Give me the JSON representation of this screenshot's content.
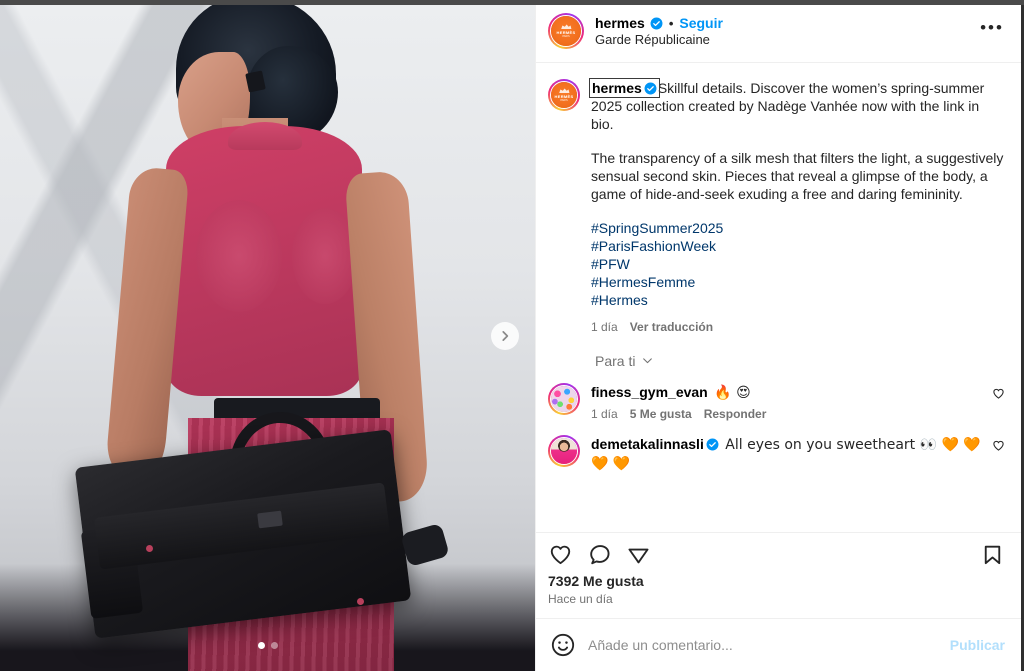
{
  "post": {
    "header": {
      "username": "hermes",
      "verified": true,
      "separator": "•",
      "follow_label": "Seguir",
      "location": "Garde Républicaine",
      "more_label": "•••",
      "avatar": {
        "name": "hermes-avatar",
        "logo_text": "HERMÈS",
        "logo_sub": "PARIS"
      }
    },
    "caption": {
      "username": "hermes",
      "verified": true,
      "paragraph1": "Skillful details. Discover the women’s spring-summer 2025 collection created by Nadège Vanhée now with the link in bio.",
      "paragraph2": "The transparency of a silk mesh that filters the light, a suggestively sensual second skin. Pieces that reveal a glimpse of the body, a game of hide-and-seek exuding a free and daring femininity.",
      "hashtags": [
        "#SpringSummer2025",
        "#ParisFashionWeek",
        "#PFW",
        "#HermesFemme",
        "#Hermes"
      ],
      "time": "1 día",
      "translate_label": "Ver traducción"
    },
    "comments_filter": {
      "label": "Para ti",
      "icon": "chevron-down-icon"
    },
    "comments": [
      {
        "username": "finess_gym_evan",
        "verified": false,
        "text": " 🔥 😍",
        "time": "1 día",
        "likes": "5 Me gusta",
        "reply": "Responder",
        "avatar": "confetti"
      },
      {
        "username": "demetakalinnasli",
        "verified": true,
        "text": " All eyes on you sweetheart 👀 🧡 🧡 🧡 🧡",
        "time": "",
        "likes": "",
        "reply": "",
        "avatar": "portrait"
      }
    ],
    "actions": {
      "like": "heart-icon",
      "comment": "comment-icon",
      "share": "share-icon",
      "save": "bookmark-icon"
    },
    "likes_count": "7392 Me gusta",
    "posted_time": "Hace un día",
    "add_comment": {
      "placeholder": "Añade un comentario...",
      "publish_label": "Publicar",
      "emoji_icon": "smiley-icon"
    }
  },
  "media": {
    "carousel": {
      "next_label": "chevron-right-icon",
      "dots_total": 2,
      "active_dot": 1
    },
    "alt": "Model seen from behind in pink sheer Hermès top holding a black Birkin-style bag"
  },
  "colors": {
    "link_blue": "#0095f6",
    "hashtag_blue": "#00376b",
    "muted_gray": "#737373",
    "text_dark": "#262626",
    "publish_disabled": "#b2dffc"
  }
}
